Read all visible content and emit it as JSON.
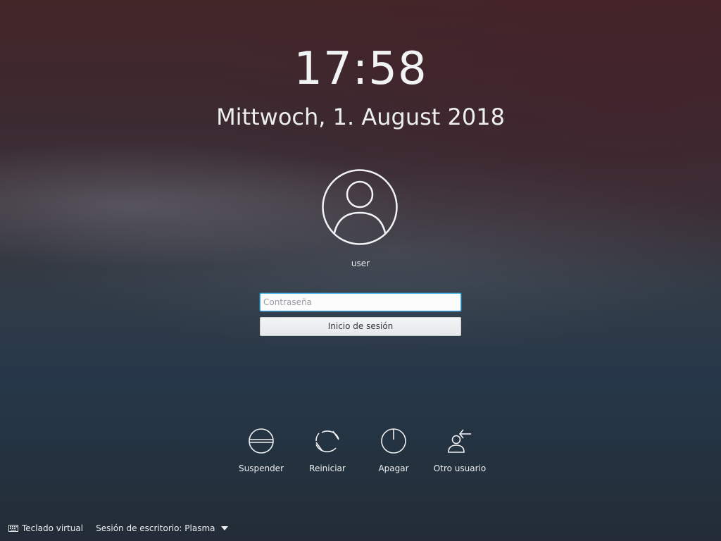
{
  "clock": {
    "time": "17:58",
    "date": "Mittwoch, 1. August 2018"
  },
  "user": {
    "name": "user",
    "avatar_icon": "user-avatar-icon"
  },
  "login": {
    "password_placeholder": "Contraseña",
    "password_value": "",
    "submit_label": "Inicio de sesión"
  },
  "actions": [
    {
      "label": "Suspender",
      "icon": "suspend-icon"
    },
    {
      "label": "Reiniciar",
      "icon": "restart-icon"
    },
    {
      "label": "Apagar",
      "icon": "power-icon"
    },
    {
      "label": "Otro usuario",
      "icon": "switch-user-icon"
    }
  ],
  "footer": {
    "virtual_keyboard_label": "Teclado virtual",
    "session_label": "Sesión de escritorio: Plasma"
  },
  "colors": {
    "focus_accent": "#3daee9",
    "background_top": "#432628",
    "background_bottom": "#232c37"
  }
}
